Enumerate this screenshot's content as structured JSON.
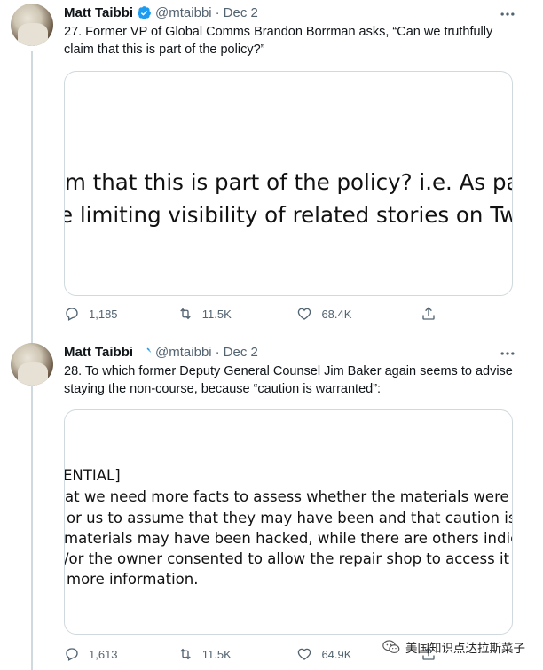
{
  "tweets": [
    {
      "author": "Matt Taibbi",
      "handle": "@mtaibbi",
      "separator": "·",
      "date": "Dec 2",
      "text": "27. Former VP of Global Comms Brandon Borrman asks, “Can we truthfully claim that this is part of the policy?”",
      "media_lines": [
        "m that this is part of the policy? i.e. As pa",
        "e limiting visibility of related stories on Tw"
      ],
      "replies": "1,185",
      "retweets": "11.5K",
      "likes": "68.4K"
    },
    {
      "author": "Matt Taibbi",
      "handle": "@mtaibbi",
      "separator": "·",
      "date": "Dec 2",
      "text": "28. To which former Deputy General Counsel Jim Baker again seems to advise staying the non-course, because “caution is warranted”:",
      "media_lines": [
        "ENTIAL]",
        "at we need more facts to assess whether the materials were hack",
        "or us to assume that they may have been and that caution is warr",
        "materials may have been hacked, while there are others indicatin",
        "/or the owner consented to allow the repair shop to access it for",
        "more information."
      ],
      "replies": "1,613",
      "retweets": "11.5K",
      "likes": "64.9K"
    }
  ],
  "watermark": "美国知识点达拉斯菜子",
  "colors": {
    "verified": "#1d9bf0",
    "secondary_text": "#536471",
    "border": "#cfd9de"
  },
  "icons": [
    "verified-icon",
    "more-icon",
    "reply-icon",
    "retweet-icon",
    "like-icon",
    "share-icon",
    "wechat-icon"
  ]
}
